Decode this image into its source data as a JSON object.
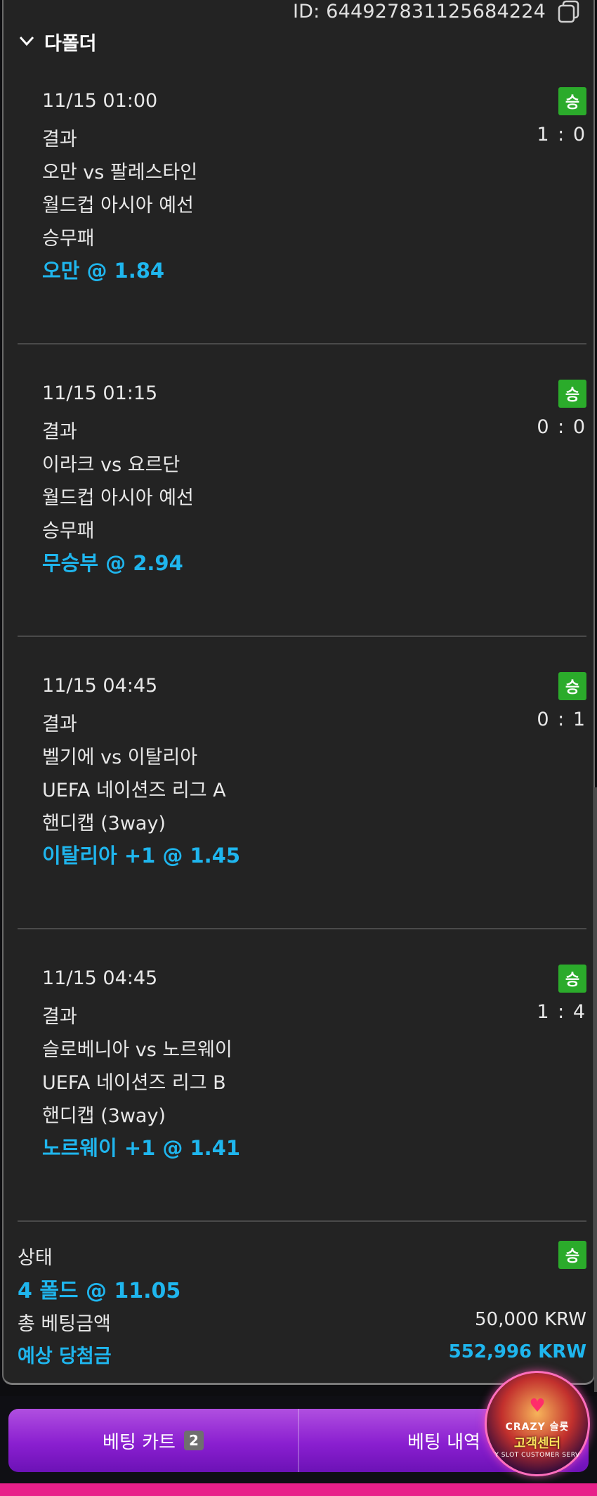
{
  "header": {
    "id_text": "ID: 644927831125684224",
    "parlay_label": "다폴더"
  },
  "bets": [
    {
      "datetime": "11/15 01:00",
      "status_badge": "승",
      "result_label": "결과",
      "score": "1 : 0",
      "match": "오만 vs 팔레스타인",
      "league": "월드컵 아시아 예선",
      "market": "승무패",
      "pick": "오만 @ 1.84"
    },
    {
      "datetime": "11/15 01:15",
      "status_badge": "승",
      "result_label": "결과",
      "score": "0 : 0",
      "match": "이라크 vs 요르단",
      "league": "월드컵 아시아 예선",
      "market": "승무패",
      "pick": "무승부 @ 2.94"
    },
    {
      "datetime": "11/15 04:45",
      "status_badge": "승",
      "result_label": "결과",
      "score": "0 : 1",
      "match": "벨기에 vs 이탈리아",
      "league": "UEFA 네이션즈 리그 A",
      "market": "핸디캡 (3way)",
      "pick": "이탈리아 +1 @ 1.45"
    },
    {
      "datetime": "11/15 04:45",
      "status_badge": "승",
      "result_label": "결과",
      "score": "1 : 4",
      "match": "슬로베니아 vs 노르웨이",
      "league": "UEFA 네이션즈 리그 B",
      "market": "핸디캡 (3way)",
      "pick": "노르웨이 +1 @ 1.41"
    }
  ],
  "summary": {
    "status_label": "상태",
    "status_badge": "승",
    "total_pick": "4 폴드 @ 11.05",
    "stake_label": "총 베팅금액",
    "stake_value": "50,000 KRW",
    "payout_label": "예상 당첨금",
    "payout_value": "552,996 KRW"
  },
  "bottom_nav": {
    "cart_label": "베팅 카트",
    "cart_count": "2",
    "history_label": "베팅 내역"
  },
  "support_badge": {
    "brand": "CRAZY",
    "brand_suffix": "슬롯",
    "title": "고객센터",
    "subtitle": "Y SLOT CUSTOMER SERV"
  },
  "colors": {
    "accent_blue": "#1fb6ee",
    "win_green": "#2bab2b",
    "panel_bg": "#232323",
    "button_purple": "#8a1fd0"
  }
}
